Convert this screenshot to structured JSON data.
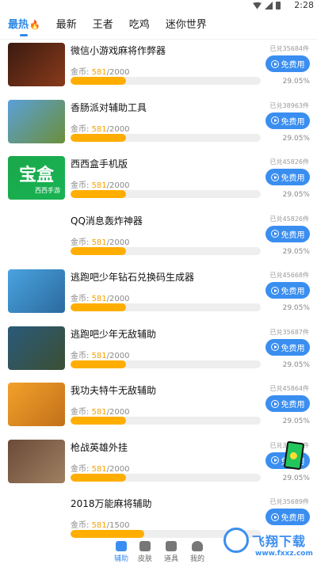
{
  "status_bar": {
    "time": "2:28"
  },
  "tabs": [
    {
      "label": "最热",
      "active": true,
      "badge_icon": "fire-icon"
    },
    {
      "label": "最新"
    },
    {
      "label": "王者"
    },
    {
      "label": "吃鸡"
    },
    {
      "label": "迷你世界"
    }
  ],
  "items": [
    {
      "name": "微信小游戏麻将作弊器",
      "coins_label": "金币:",
      "coins_current": "581",
      "coins_total": "/2000",
      "exchanged": "已兑35684件",
      "button": "免费用",
      "percent": "29.05%",
      "progress": 0.2905,
      "thumb_colors": [
        "#3a1a10",
        "#8a3b1b"
      ]
    },
    {
      "name": "香肠派对辅助工具",
      "coins_label": "金币:",
      "coins_current": "581",
      "coins_total": "/2000",
      "exchanged": "已兑38963件",
      "button": "免费用",
      "percent": "29.05%",
      "progress": 0.2905,
      "thumb_colors": [
        "#5aa0d8",
        "#6b8f3a"
      ]
    },
    {
      "name": "西西盒手机版",
      "coins_label": "金币:",
      "coins_current": "581",
      "coins_total": "/2000",
      "exchanged": "已兑45826件",
      "button": "免费用",
      "percent": "29.05%",
      "progress": 0.2905,
      "thumb_colors": [
        "#1aa84a",
        "#18b354"
      ],
      "thumb_text": "宝盒",
      "thumb_subtext": "西西手游"
    },
    {
      "name": "QQ消息轰炸神器",
      "coins_label": "金币:",
      "coins_current": "581",
      "coins_total": "/2000",
      "exchanged": "已兑45826件",
      "button": "免费用",
      "percent": "29.05%",
      "progress": 0.2905,
      "thumb_colors": [
        "#ffffff",
        "#ffffff"
      ]
    },
    {
      "name": "逃跑吧少年钻石兑换码生成器",
      "coins_label": "金币:",
      "coins_current": "581",
      "coins_total": "/2000",
      "exchanged": "已兑45668件",
      "button": "免费用",
      "percent": "29.05%",
      "progress": 0.2905,
      "thumb_colors": [
        "#4aa3e0",
        "#2b6a9e"
      ]
    },
    {
      "name": "逃跑吧少年无敌辅助",
      "coins_label": "金币:",
      "coins_current": "581",
      "coins_total": "/2000",
      "exchanged": "已兑35687件",
      "button": "免费用",
      "percent": "29.05%",
      "progress": 0.2905,
      "thumb_colors": [
        "#2a5a7a",
        "#3b4f33"
      ]
    },
    {
      "name": "我功夫特牛无敌辅助",
      "coins_label": "金币:",
      "coins_current": "581",
      "coins_total": "/2000",
      "exchanged": "已兑45864件",
      "button": "免费用",
      "percent": "29.05%",
      "progress": 0.2905,
      "thumb_colors": [
        "#f2a12a",
        "#c2701a"
      ]
    },
    {
      "name": "枪战英雄外挂",
      "coins_label": "金币:",
      "coins_current": "581",
      "coins_total": "/2000",
      "exchanged": "已兑35684件",
      "button": "免费用",
      "percent": "29.05%",
      "progress": 0.2905,
      "thumb_colors": [
        "#6b4a3a",
        "#a08060"
      ]
    },
    {
      "name": "2018万能麻将辅助",
      "coins_label": "金币:",
      "coins_current": "581",
      "coins_total": "/1500",
      "exchanged": "已兑35689件",
      "button": "免费用",
      "percent": "",
      "progress": 0.387,
      "thumb_colors": [
        "#ffffff",
        "#ffffff"
      ]
    }
  ],
  "bottom_nav": [
    {
      "label": "辅助",
      "icon": "pencil-icon",
      "active": true
    },
    {
      "label": "皮肤",
      "icon": "shirt-icon"
    },
    {
      "label": "道具",
      "icon": "box-icon"
    },
    {
      "label": "我的",
      "icon": "user-icon"
    }
  ],
  "watermark": {
    "text": "飞翔下载",
    "url": "www.fxxz.com"
  },
  "colors": {
    "accent": "#3a8ef0",
    "progress": "#ffae00",
    "coins": "#f5a300"
  }
}
